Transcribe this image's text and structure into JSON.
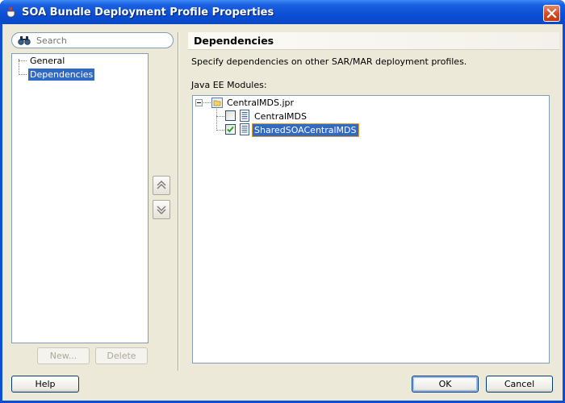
{
  "window": {
    "title": "SOA Bundle Deployment Profile Properties"
  },
  "search": {
    "placeholder": "Search"
  },
  "nav": {
    "items": [
      {
        "label": "General",
        "selected": false
      },
      {
        "label": "Dependencies",
        "selected": true
      }
    ],
    "new_label": "New...",
    "delete_label": "Delete"
  },
  "panel": {
    "title": "Dependencies",
    "description": "Specify dependencies on other SAR/MAR deployment profiles.",
    "modules_label": "Java EE Modules:",
    "tree": {
      "root": {
        "label": "CentralMDS.jpr",
        "icon": "folder-icon",
        "expanded": true
      },
      "children": [
        {
          "label": "CentralMDS",
          "checked": false,
          "selected": false,
          "icon": "document-icon"
        },
        {
          "label": "SharedSOACentralMDS",
          "checked": true,
          "selected": true,
          "icon": "document-icon"
        }
      ]
    },
    "move_up_icon": "double-chevron-up-icon",
    "move_down_icon": "double-chevron-down-icon"
  },
  "footer": {
    "help_label": "Help",
    "ok_label": "OK",
    "cancel_label": "Cancel"
  },
  "colors": {
    "titlebar": "#0a4fd4",
    "selection": "#316ac5",
    "dialog_bg": "#ece9d8"
  }
}
